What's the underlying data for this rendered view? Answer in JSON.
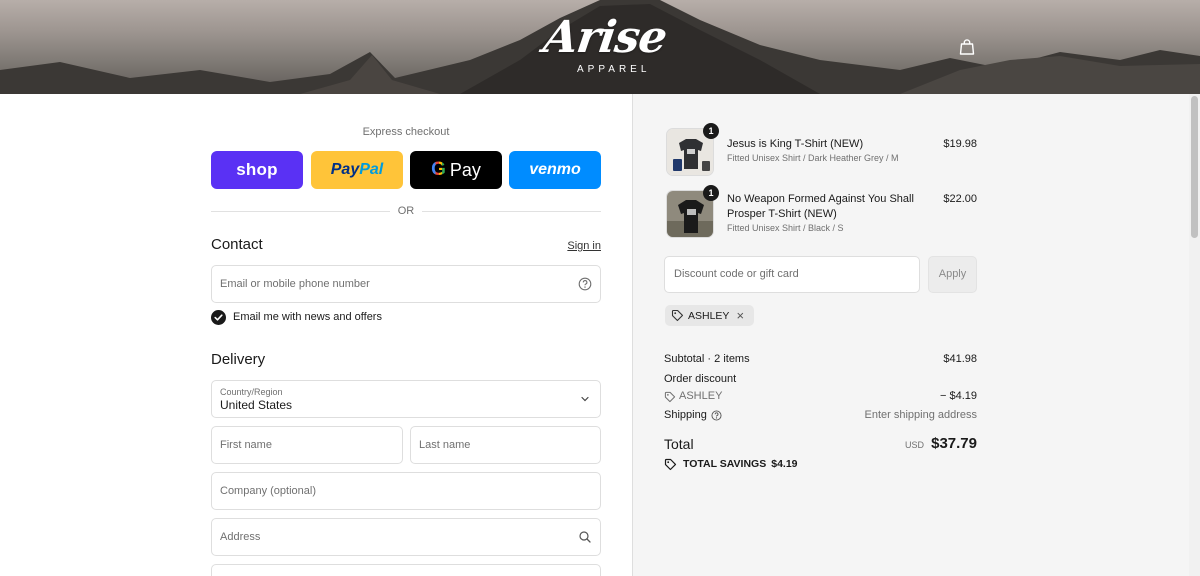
{
  "brand": {
    "logo_script": "Arise",
    "logo_sub": "APPAREL"
  },
  "header": {
    "cart_icon": "shopping-bag-icon"
  },
  "express": {
    "label": "Express checkout",
    "shop": "shop",
    "paypal_a": "Pay",
    "paypal_b": "Pal",
    "gpay_g": "G",
    "gpay_text": "Pay",
    "venmo": "venmo",
    "or": "OR",
    "colors": {
      "shop": "#5a31f4",
      "paypal": "#ffc439",
      "gpay": "#000000",
      "venmo": "#008cff"
    }
  },
  "contact": {
    "title": "Contact",
    "signin": "Sign in",
    "email_placeholder": "Email or mobile phone number",
    "news_label": "Email me with news and offers",
    "news_checked": true
  },
  "delivery": {
    "title": "Delivery",
    "country_label": "Country/Region",
    "country_value": "United States",
    "first_name": "First name",
    "last_name": "Last name",
    "company": "Company (optional)",
    "address": "Address"
  },
  "summary": {
    "items": [
      {
        "name": "Jesus is King T-Shirt (NEW)",
        "variant": "Fitted Unisex Shirt / Dark Heather Grey / M",
        "price": "$19.98",
        "qty": "1"
      },
      {
        "name": "No Weapon Formed Against You Shall Prosper T-Shirt (NEW)",
        "variant": "Fitted Unisex Shirt / Black / S",
        "price": "$22.00",
        "qty": "1"
      }
    ],
    "discount_placeholder": "Discount code or gift card",
    "apply": "Apply",
    "code": "ASHLEY",
    "subtotal_label": "Subtotal · 2 items",
    "subtotal_value": "$41.98",
    "order_discount_label": "Order discount",
    "discount_code": "ASHLEY",
    "discount_value": "− $4.19",
    "shipping_label": "Shipping",
    "shipping_value": "Enter shipping address",
    "total_label": "Total",
    "currency": "USD",
    "total_value": "$37.79",
    "savings_label": "TOTAL SAVINGS",
    "savings_value": "$4.19"
  }
}
